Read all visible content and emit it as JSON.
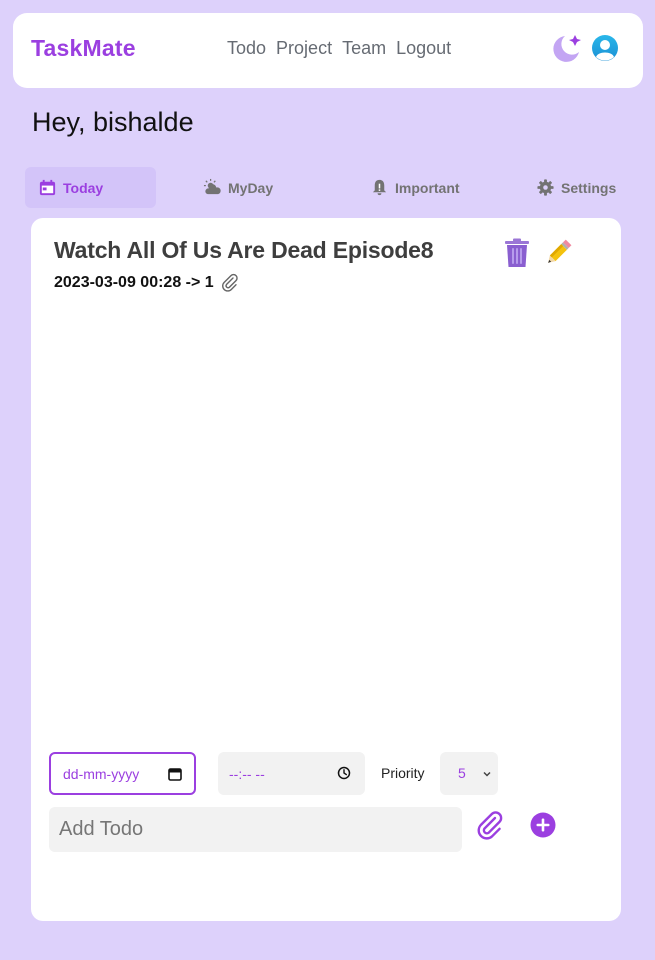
{
  "header": {
    "brand": "TaskMate",
    "nav": [
      "Todo",
      "Project",
      "Team",
      "Logout"
    ],
    "theme_icon": "moon-icon",
    "avatar_icon": "user-avatar-icon"
  },
  "greeting": "Hey, bishalde",
  "tabs": [
    {
      "label": "Today",
      "icon": "calendar-icon",
      "active": true
    },
    {
      "label": "MyDay",
      "icon": "cloud-sun-icon",
      "active": false
    },
    {
      "label": "Important",
      "icon": "bell-alert-icon",
      "active": false
    },
    {
      "label": "Settings",
      "icon": "gear-icon",
      "active": false
    }
  ],
  "todo": {
    "title": "Watch All Of Us Are Dead Episode8",
    "meta": "2023-03-09 00:28 -> 1"
  },
  "form": {
    "date_placeholder": "dd-mm-yyyy",
    "time_placeholder": "--:-- --",
    "priority_label": "Priority",
    "priority_value": "5",
    "add_placeholder": "Add Todo"
  },
  "colors": {
    "background": "#ddd1fb",
    "accent": "#9b3fe0",
    "active_tab_bg": "#d3c4f9",
    "card": "#ffffff"
  }
}
